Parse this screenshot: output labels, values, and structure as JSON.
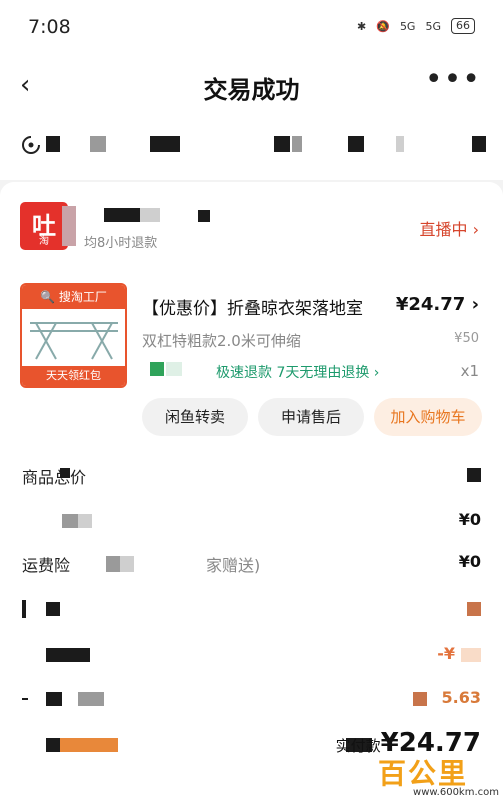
{
  "status_bar": {
    "time": "7:08",
    "net1": "5G",
    "net2": "5G",
    "battery": "66"
  },
  "header": {
    "back_glyph": "‹",
    "title": "交易成功",
    "more_glyph": "•••"
  },
  "shop": {
    "logo_top": "吐",
    "logo_bottom": "淘",
    "name": "",
    "sub": "均8小时退款",
    "live_label": "直播中 ›"
  },
  "product": {
    "thumb_banner": "🔍 搜淘工厂",
    "thumb_footer": "天天领红包",
    "title": "【优惠价】折叠晾衣架落地室",
    "price": "¥24.77 ›",
    "spec": "双杠特粗款2.0米可伸缩",
    "orig_price": "¥50",
    "tags": "极速退款  7天无理由退换 ›",
    "qty": "x1"
  },
  "actions": {
    "resell": "闲鱼转卖",
    "after_sale": "申请售后",
    "add_cart": "加入购物车"
  },
  "summary": {
    "rows": [
      {
        "label": "商品总价",
        "value": ""
      },
      {
        "label": "",
        "value": "¥0"
      },
      {
        "label": "运费险",
        "value": "¥0"
      },
      {
        "label": "",
        "value": ""
      },
      {
        "label": "",
        "value": "-¥"
      },
      {
        "label": "",
        "value": "5.63"
      }
    ],
    "paid_label": "实付款",
    "paid_amount": "¥24.77",
    "note": "家赠送)"
  },
  "watermark": {
    "text": "百公里",
    "url": "www.600km.com"
  },
  "colors": {
    "accent": "#e8542d",
    "live": "#d6452c",
    "green": "#1d9a6c",
    "orange": "#e8761f"
  }
}
